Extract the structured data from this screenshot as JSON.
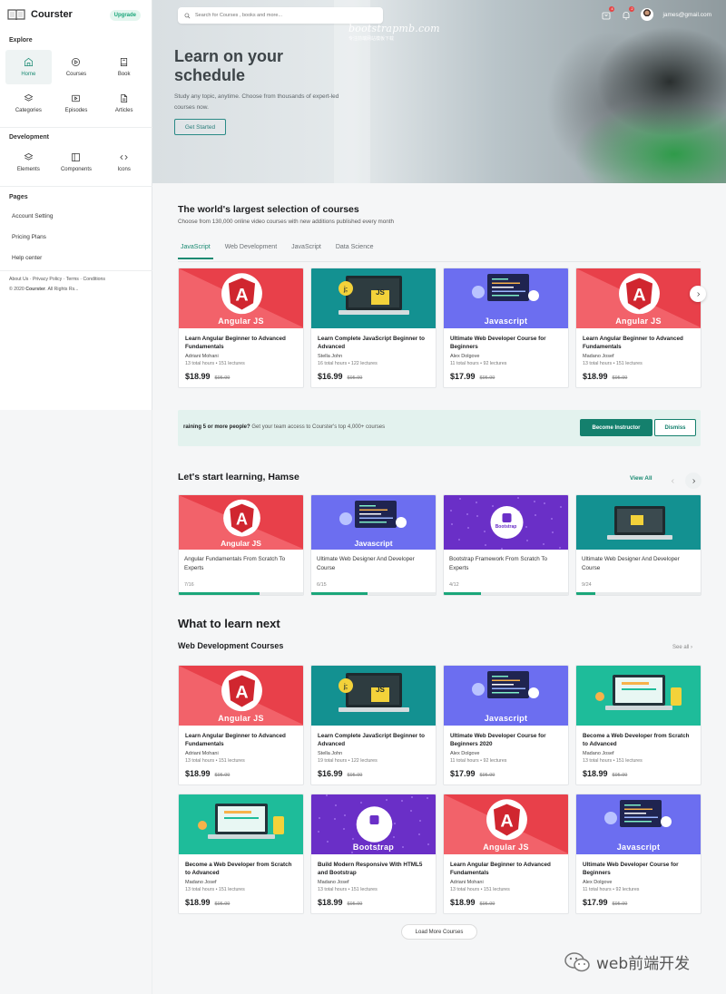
{
  "brand": {
    "name": "Courster",
    "upgrade": "Upgrade"
  },
  "sidebar": {
    "explore_title": "Explore",
    "explore_items": [
      {
        "label": "Home",
        "icon": "home-icon"
      },
      {
        "label": "Courses",
        "icon": "play-circle-icon"
      },
      {
        "label": "Book",
        "icon": "book-icon"
      },
      {
        "label": "Categories",
        "icon": "layers-icon"
      },
      {
        "label": "Episodes",
        "icon": "video-icon"
      },
      {
        "label": "Articles",
        "icon": "file-icon"
      }
    ],
    "development_title": "Development",
    "development_items": [
      {
        "label": "Elements",
        "icon": "layers-icon"
      },
      {
        "label": "Components",
        "icon": "columns-icon"
      },
      {
        "label": "Icons",
        "icon": "code-icon"
      }
    ],
    "pages_title": "Pages",
    "pages": [
      "Account Setting",
      "Pricing Plans",
      "Help center"
    ],
    "footer_links": "About Us · Privacy Policy · Terms · Conditions",
    "copyright_prefix": "© 2020 ",
    "copyright_brand": "Courster",
    "copyright_suffix": ". All Rights Rs..."
  },
  "header": {
    "search_placeholder": "Search for Courses , books and more...",
    "watermark": "bootstrapmb.com",
    "watermark_sub": "专注前端网站模板下载",
    "email": "james@gmail.com",
    "badge_cart": "4",
    "badge_bell": "2"
  },
  "hero": {
    "title": "Learn on your schedule",
    "subtitle": "Study any topic, anytime. Choose from thousands of expert-led courses now.",
    "cta": "Get Started"
  },
  "selection": {
    "title": "The world's largest selection of courses",
    "subtitle": "Choose from 130,000 online video courses with new additions published every month",
    "tabs": [
      "JavaScript",
      "Web Development",
      "JavaScript",
      "Data Science"
    ],
    "courses": [
      {
        "thumb": "angular",
        "thumb_label": "Angular JS",
        "title": "Learn Angular Beginner to Advanced Fundamentals",
        "author": "Adriani Mohani",
        "meta": "13 total hours  •  151 lectures",
        "price": "$18.99",
        "old": "$95.99"
      },
      {
        "thumb": "js",
        "thumb_label": "JS",
        "title": "Learn Complete JavaScript Beginner to Advanced",
        "author": "Stella John",
        "meta": "16 total hours  •  122 lectures",
        "price": "$16.99",
        "old": "$95.99"
      },
      {
        "thumb": "javascript",
        "thumb_label": "Javascript",
        "title": "Ultimate Web Developer Course for Beginners",
        "author": "Alex Dolgove",
        "meta": "11 total hours  •  92 lectures",
        "price": "$17.99",
        "old": "$95.99"
      },
      {
        "thumb": "angular",
        "thumb_label": "Angular JS",
        "title": "Learn Angular Beginner to Advanced Fundamentals",
        "author": "Madano Josef",
        "meta": "13 total hours  •  151 lectures",
        "price": "$18.99",
        "old": "$95.99"
      }
    ]
  },
  "banner": {
    "bold": "raining 5 or more people?",
    "text": " Get your team access to Courster's top 4,000+ courses",
    "primary": "Become Instructor",
    "secondary": "Dismiss"
  },
  "learning": {
    "title": "Let's start learning, Hamse",
    "view_all": "View All",
    "items": [
      {
        "thumb": "angular",
        "thumb_label": "Angular JS",
        "title": "Angular Fundamentals From Scratch To Experts",
        "count": "7/16",
        "progress": 0.65
      },
      {
        "thumb": "javascript",
        "thumb_label": "Javascript",
        "title": "Ultimate Web Designer And Developer Course",
        "count": "6/15",
        "progress": 0.45
      },
      {
        "thumb": "bootstrap",
        "thumb_label": "Bootstrap",
        "title": "Bootstrap Framework From Scratch To Experts",
        "count": "4/12",
        "progress": 0.3
      },
      {
        "thumb": "laptop-teal",
        "thumb_label": "",
        "title": "Ultimate Web Designer And Developer Course",
        "count": "9/24",
        "progress": 0.15
      }
    ]
  },
  "next": {
    "title": "What to learn next",
    "subtitle": "Web Development Courses",
    "see_all": "See all",
    "courses": [
      {
        "thumb": "angular",
        "thumb_label": "Angular JS",
        "title": "Learn Angular Beginner to Advanced Fundamentals",
        "author": "Adriani Mohani",
        "meta": "13 total hours  •  151 lectures",
        "price": "$18.99",
        "old": "$95.99"
      },
      {
        "thumb": "js",
        "thumb_label": "JS",
        "title": "Learn Complete JavaScript Beginner to Advanced",
        "author": "Stella John",
        "meta": "19 total hours  •  122 lectures",
        "price": "$16.99",
        "old": "$95.99"
      },
      {
        "thumb": "javascript",
        "thumb_label": "Javascript",
        "title": "Ultimate Web Developer Course for Beginners 2020",
        "author": "Alex Dolgove",
        "meta": "11 total hours  •  92 lectures",
        "price": "$17.99",
        "old": "$95.99"
      },
      {
        "thumb": "webdev",
        "thumb_label": "",
        "title": "Become a Web Developer from Scratch to Advanced",
        "author": "Madano Josef",
        "meta": "13 total hours  •  151 lectures",
        "price": "$18.99",
        "old": "$95.99"
      },
      {
        "thumb": "webdev",
        "thumb_label": "",
        "title": "Become a Web Developer from Scratch to Advanced",
        "author": "Madano Josef",
        "meta": "13 total hours  •  151 lectures",
        "price": "$18.99",
        "old": "$95.99"
      },
      {
        "thumb": "bootstrap",
        "thumb_label": "Bootstrap",
        "title": "Build Modern Responsive With HTML5 and Bootstrap",
        "author": "Madano Josef",
        "meta": "13 total hours  •  151 lectures",
        "price": "$18.99",
        "old": "$95.99"
      },
      {
        "thumb": "angular",
        "thumb_label": "Angular JS",
        "title": "Learn Angular Beginner to Advanced Fundamentals",
        "author": "Adriani Mohani",
        "meta": "13 total hours  •  151 lectures",
        "price": "$18.99",
        "old": "$95.99"
      },
      {
        "thumb": "javascript",
        "thumb_label": "Javascript",
        "title": "Ultimate Web Developer Course for Beginners",
        "author": "Alex Dolgove",
        "meta": "11 total hours  •  92 lectures",
        "price": "$17.99",
        "old": "$95.99"
      }
    ],
    "load_more": "Load More Courses"
  },
  "wechat": {
    "label": "web前端开发"
  },
  "colors": {
    "accent": "#1a8a72",
    "angular": "#e8404a",
    "js": "#139191",
    "javascript": "#6c6ef0",
    "bootstrap": "#6a2fc7",
    "webdev": "#1ebc9a"
  }
}
